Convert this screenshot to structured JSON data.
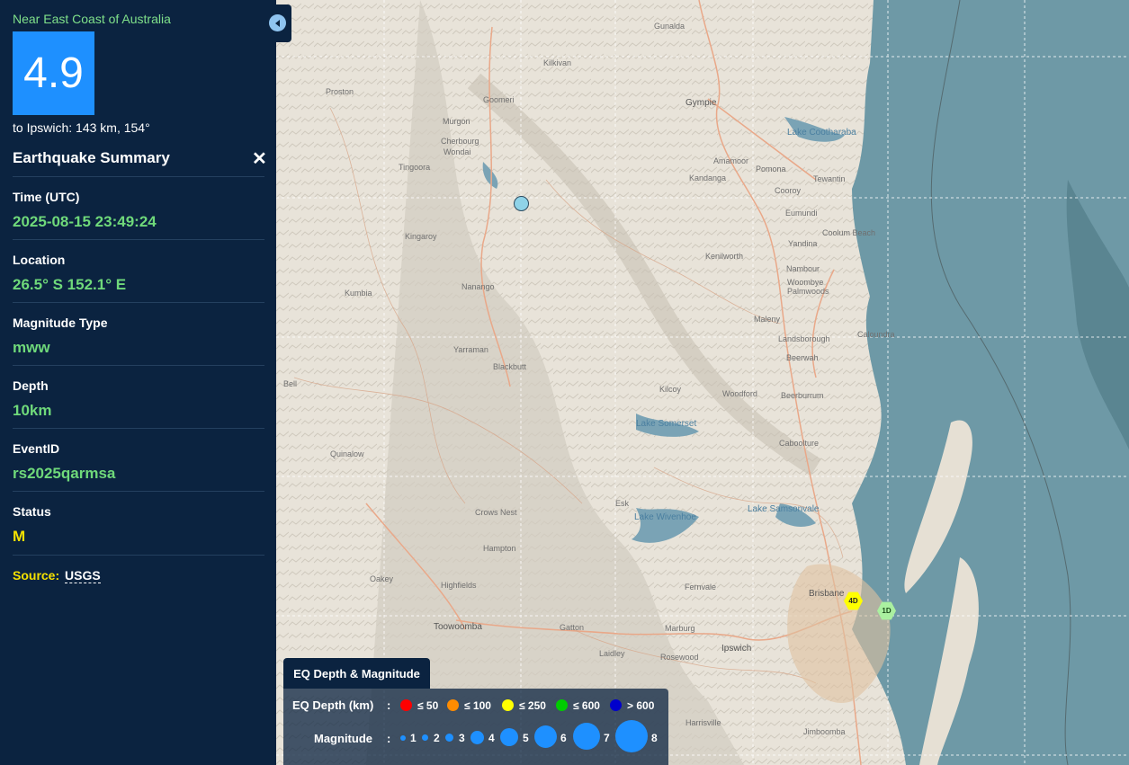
{
  "sidebar": {
    "region": "Near East Coast of Australia",
    "magnitude": "4.9",
    "nearby": "to Ipswich: 143 km, 154°",
    "summary_title": "Earthquake Summary",
    "close_label": "✕",
    "fields": [
      {
        "label": "Time (UTC)",
        "value": "2025-08-15 23:49:24"
      },
      {
        "label": "Location",
        "value": "26.5° S 152.1° E"
      },
      {
        "label": "Magnitude Type",
        "value": "mww"
      },
      {
        "label": "Depth",
        "value": "10km"
      },
      {
        "label": "EventID",
        "value": "rs2025qarmsa"
      },
      {
        "label": "Status",
        "value": "M"
      }
    ],
    "source_label": "Source:",
    "source_value": "USGS"
  },
  "map": {
    "places": [
      "Gunalda",
      "Kilkivan",
      "Proston",
      "Goomeri",
      "Gympie",
      "Murgon",
      "Cherbourg",
      "Wondai",
      "Tingoora",
      "Lake Cootharaba",
      "Amamoor",
      "Pomona",
      "Kandanga",
      "Tewantin",
      "Cooroy",
      "Eumundi",
      "Coolum Beach",
      "Kingaroy",
      "Yandina",
      "Kenilworth",
      "Nambour",
      "Woombye",
      "Palmwoods",
      "Kumbia",
      "Nanango",
      "Maleny",
      "Caloundra",
      "Landsborough",
      "Beerwah",
      "Yarraman",
      "Blackbutt",
      "Kilcoy",
      "Woodford",
      "Beerburrum",
      "Bell",
      "Lake Somerset",
      "Caboolture",
      "Quinalow",
      "Esk",
      "Lake Wivenhoe",
      "Lake Samsonvale",
      "Crows Nest",
      "Hampton",
      "Oakey",
      "Highfields",
      "Fernvale",
      "Brisbane",
      "Toowoomba",
      "Gatton",
      "Marburg",
      "Ipswich",
      "Laidley",
      "Rosewood",
      "Harrisville",
      "Jimboomba"
    ],
    "markers": [
      {
        "label": "4D"
      },
      {
        "label": "1D"
      }
    ],
    "colors": {
      "land": "#e8e3d9",
      "water": "#6e99a6",
      "event_marker": "#8fd3e8"
    }
  },
  "legend": {
    "title": "EQ Depth & Magnitude",
    "depth_label": "EQ Depth (km)",
    "depth_sep": ":",
    "depths": [
      {
        "label": "≤ 50",
        "color": "#ff0000"
      },
      {
        "label": "≤ 100",
        "color": "#ff8c00"
      },
      {
        "label": "≤ 250",
        "color": "#ffff00"
      },
      {
        "label": "≤ 600",
        "color": "#00cc00"
      },
      {
        "label": "> 600",
        "color": "#0000cc"
      }
    ],
    "mag_label": "Magnitude",
    "mag_sep": ":",
    "mags": [
      "1",
      "2",
      "3",
      "4",
      "5",
      "6",
      "7",
      "8"
    ],
    "mag_color": "#1e90ff"
  }
}
